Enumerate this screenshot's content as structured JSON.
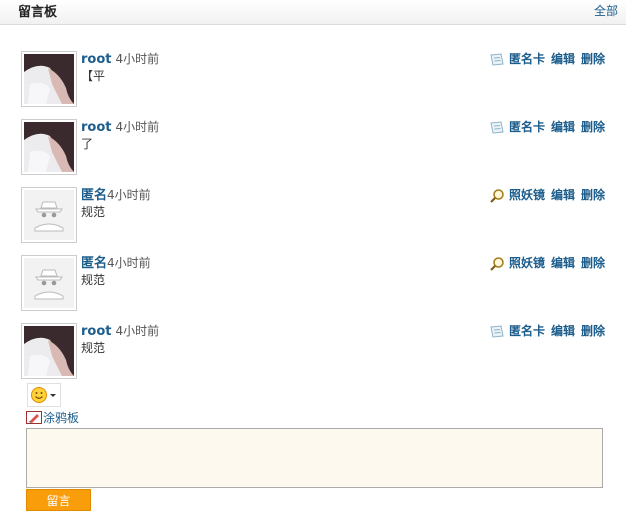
{
  "header": {
    "title": "留言板",
    "all_link": "全部"
  },
  "comments": [
    {
      "user": "root",
      "time": "4小时前",
      "text": "【平",
      "avatar": "photo",
      "action1": "匿名卡",
      "action1_icon": "card-icon",
      "edit": "编辑",
      "delete": "删除"
    },
    {
      "user": "root",
      "time": "4小时前",
      "text": "了",
      "avatar": "photo",
      "action1": "匿名卡",
      "action1_icon": "card-icon",
      "edit": "编辑",
      "delete": "删除"
    },
    {
      "user": "匿名",
      "time": "4小时前",
      "text": "规范",
      "avatar": "anonymous",
      "action1": "照妖镜",
      "action1_icon": "magnifier-icon",
      "edit": "编辑",
      "delete": "删除"
    },
    {
      "user": "匿名",
      "time": "4小时前",
      "text": "规范",
      "avatar": "anonymous",
      "action1": "照妖镜",
      "action1_icon": "magnifier-icon",
      "edit": "编辑",
      "delete": "删除"
    },
    {
      "user": "root",
      "time": "4小时前",
      "text": "规范",
      "avatar": "photo",
      "action1": "匿名卡",
      "action1_icon": "card-icon",
      "edit": "编辑",
      "delete": "删除"
    }
  ],
  "composer": {
    "emoji_icon": "smiley-icon",
    "doodle_label": "涂鸦板",
    "textarea_value": "",
    "submit_label": "留言"
  }
}
